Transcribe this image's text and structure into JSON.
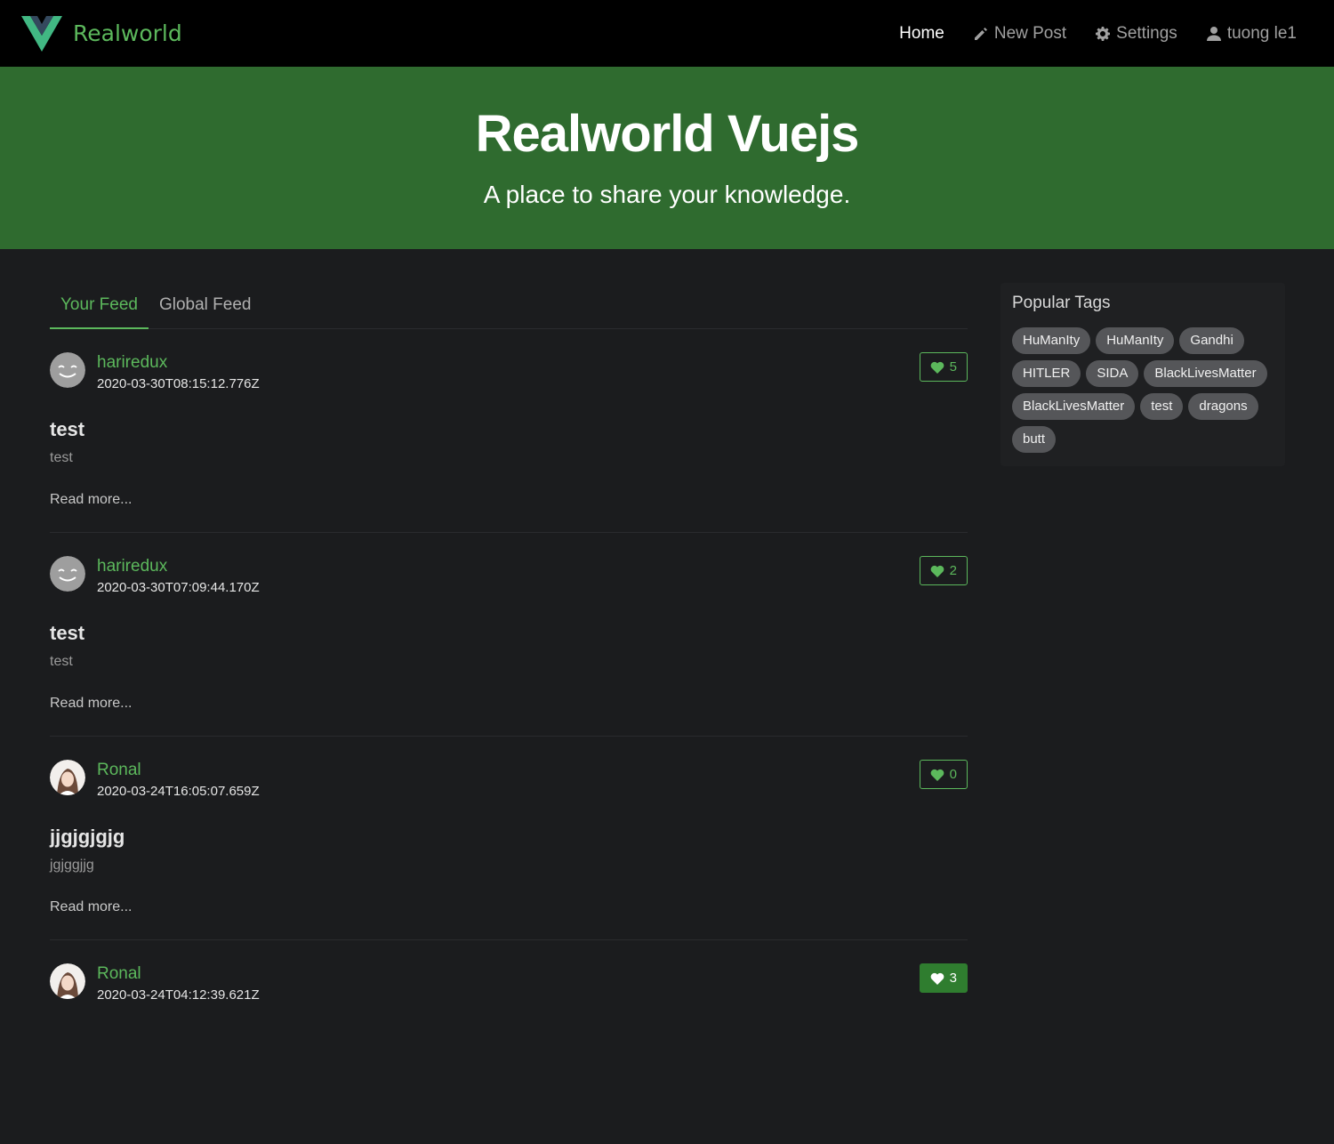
{
  "navbar": {
    "brand": "Realworld",
    "links": [
      {
        "label": "Home",
        "icon": "",
        "active": true
      },
      {
        "label": "New Post",
        "icon": "pencil-icon"
      },
      {
        "label": "Settings",
        "icon": "gear-icon"
      },
      {
        "label": "tuong le1",
        "icon": "user-icon"
      }
    ]
  },
  "banner": {
    "title": "Realworld Vuejs",
    "subtitle": "A place to share your knowledge."
  },
  "feed": {
    "tabs": [
      {
        "label": "Your Feed",
        "active": true
      },
      {
        "label": "Global Feed",
        "active": false
      }
    ],
    "articles": [
      {
        "author": "hariredux",
        "date": "2020-03-30T08:15:12.776Z",
        "favorites": "5",
        "favorited": false,
        "title": "test",
        "description": "test",
        "read_more": "Read more...",
        "avatar": "smiley-avatar"
      },
      {
        "author": "hariredux",
        "date": "2020-03-30T07:09:44.170Z",
        "favorites": "2",
        "favorited": false,
        "title": "test",
        "description": "test",
        "read_more": "Read more...",
        "avatar": "smiley-avatar"
      },
      {
        "author": "Ronal",
        "date": "2020-03-24T16:05:07.659Z",
        "favorites": "0",
        "favorited": false,
        "title": "jjgjgjgjg",
        "description": "jgjggjjg",
        "read_more": "Read more...",
        "avatar": "photo-avatar"
      },
      {
        "author": "Ronal",
        "date": "2020-03-24T04:12:39.621Z",
        "favorites": "3",
        "favorited": true,
        "title": "",
        "description": "",
        "read_more": "",
        "avatar": "photo-avatar"
      }
    ]
  },
  "sidebar": {
    "title": "Popular Tags",
    "tags": [
      "HuManIty",
      "HuManIty",
      "Gandhi",
      "HITLER",
      "SIDA",
      "BlackLivesMatter",
      "BlackLivesMatter",
      "test",
      "dragons",
      "butt"
    ]
  },
  "colors": {
    "accent": "#5cb85c",
    "banner": "#2f6b2f",
    "background": "#1b1c1e"
  }
}
